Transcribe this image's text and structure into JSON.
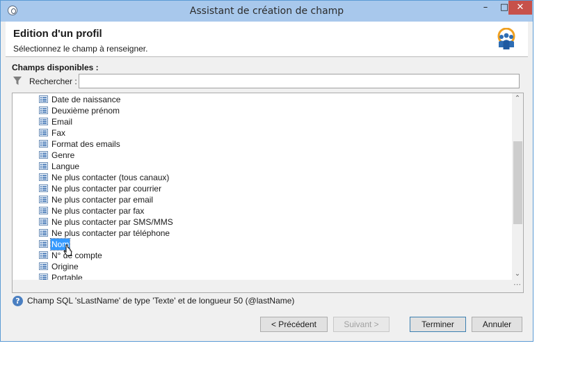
{
  "window": {
    "title": "Assistant de création de champ",
    "controls": {
      "minimize": "–",
      "maximize": "□",
      "close": "✕"
    }
  },
  "header": {
    "title": "Edition d'un profil",
    "subtitle": "Sélectionnez le champ à renseigner.",
    "icon": "people-group-icon"
  },
  "fields": {
    "section_label": "Champs disponibles :",
    "search_label": "Rechercher :",
    "search_value": "",
    "items": [
      {
        "label": "Date de naissance",
        "selected": false
      },
      {
        "label": "Deuxième prénom",
        "selected": false
      },
      {
        "label": "Email",
        "selected": false
      },
      {
        "label": "Fax",
        "selected": false
      },
      {
        "label": "Format des emails",
        "selected": false
      },
      {
        "label": "Genre",
        "selected": false
      },
      {
        "label": "Langue",
        "selected": false
      },
      {
        "label": "Ne plus contacter (tous canaux)",
        "selected": false
      },
      {
        "label": "Ne plus contacter par courrier",
        "selected": false
      },
      {
        "label": "Ne plus contacter par email",
        "selected": false
      },
      {
        "label": "Ne plus contacter par fax",
        "selected": false
      },
      {
        "label": "Ne plus contacter par SMS/MMS",
        "selected": false
      },
      {
        "label": "Ne plus contacter par téléphone",
        "selected": false
      },
      {
        "label": "Nom",
        "selected": true
      },
      {
        "label": "N° de compte",
        "selected": false
      },
      {
        "label": "Origine",
        "selected": false
      },
      {
        "label": "Portable",
        "selected": false
      }
    ]
  },
  "info": {
    "text": "Champ SQL 'sLastName' de type 'Texte' et de longueur 50 (@lastName)"
  },
  "buttons": {
    "previous": "< Précédent",
    "next": "Suivant >",
    "finish": "Terminer",
    "cancel": "Annuler"
  },
  "colors": {
    "titlebar": "#a8c8ec",
    "selection": "#3399ff",
    "close_button": "#c7514a"
  }
}
